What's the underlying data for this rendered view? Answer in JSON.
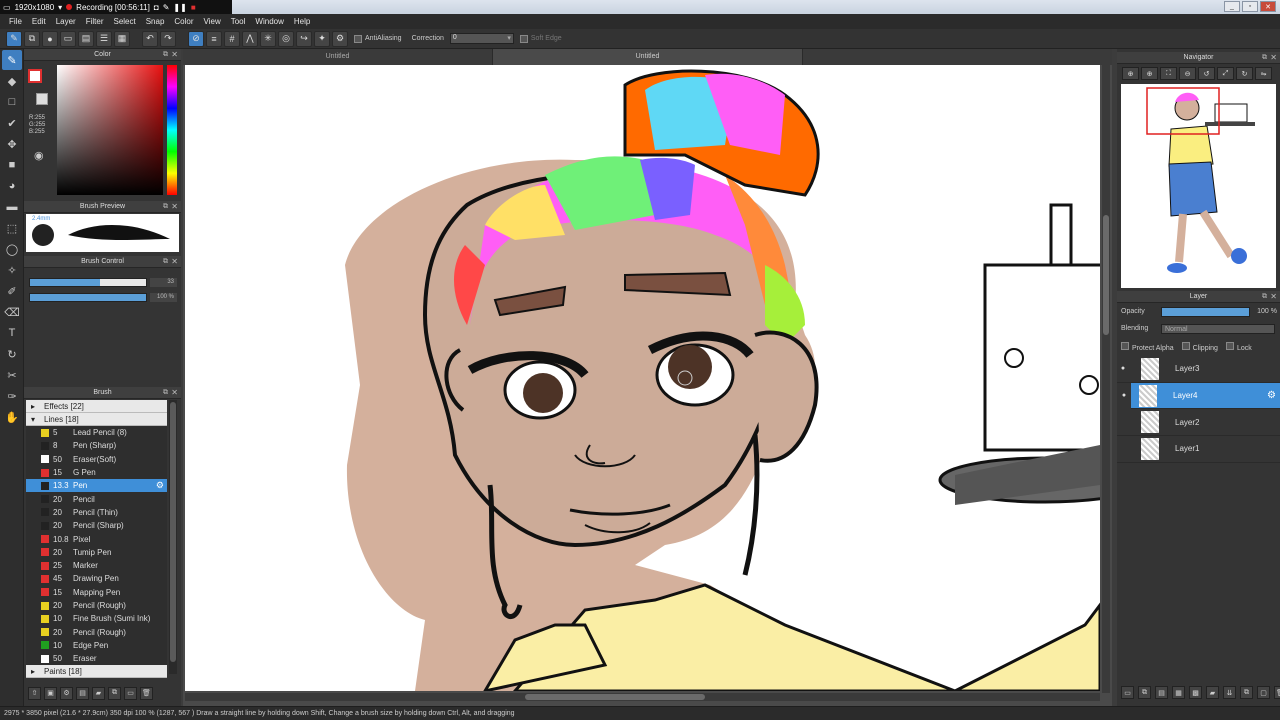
{
  "recorder": {
    "res": "1920x1080",
    "recording": "Recording [00:56:11]"
  },
  "menu": [
    "File",
    "Edit",
    "Layer",
    "Filter",
    "Select",
    "Snap",
    "Color",
    "View",
    "Tool",
    "Window",
    "Help"
  ],
  "toolbar": {
    "antialiasing": "AntiAliasing",
    "correction_label": "Correction",
    "correction_value": "0",
    "soft_edge": "Soft Edge"
  },
  "color_panel": {
    "title": "Color",
    "r": "R:255",
    "g": "G:255",
    "b": "B:255",
    "fg_color": "#ffffff"
  },
  "brush_preview": {
    "title": "Brush Preview",
    "size": "2.4mm"
  },
  "brush_control": {
    "title": "Brush Control",
    "size_value": "33",
    "size_fill": 0.6,
    "opacity_value": "100 %",
    "opacity_fill": 1.0
  },
  "brush_panel": {
    "title": "Brush",
    "groups": [
      {
        "label": "Effects [22]",
        "open": false
      },
      {
        "label": "Lines [18]",
        "open": true
      },
      {
        "label": "Paints [18]",
        "open": false
      }
    ],
    "items": [
      {
        "size": "5",
        "name": "Lead Pencil (8)",
        "color": "#e8d020"
      },
      {
        "size": "8",
        "name": "Pen (Sharp)",
        "color": "#222222"
      },
      {
        "size": "50",
        "name": "Eraser(Soft)",
        "color": "#ffffff"
      },
      {
        "size": "15",
        "name": "G Pen",
        "color": "#e03030"
      },
      {
        "size": "13.3",
        "name": "Pen",
        "color": "#222222",
        "selected": true
      },
      {
        "size": "20",
        "name": "Pencil",
        "color": "#222222"
      },
      {
        "size": "20",
        "name": "Pencil (Thin)",
        "color": "#222222"
      },
      {
        "size": "20",
        "name": "Pencil (Sharp)",
        "color": "#222222"
      },
      {
        "size": "10.8",
        "name": "Pixel",
        "color": "#e03030"
      },
      {
        "size": "20",
        "name": "Tumip Pen",
        "color": "#e03030"
      },
      {
        "size": "25",
        "name": "Marker",
        "color": "#e03030"
      },
      {
        "size": "45",
        "name": "Drawing Pen",
        "color": "#e03030"
      },
      {
        "size": "15",
        "name": "Mapping Pen",
        "color": "#e03030"
      },
      {
        "size": "20",
        "name": "Pencil (Rough)",
        "color": "#e8d020"
      },
      {
        "size": "10",
        "name": "Fine Brush (Sumi Ink)",
        "color": "#e8d020"
      },
      {
        "size": "20",
        "name": "Pencil (Rough)",
        "color": "#e8d020"
      },
      {
        "size": "10",
        "name": "Edge Pen",
        "color": "#20a020"
      },
      {
        "size": "50",
        "name": "Eraser",
        "color": "#ffffff"
      }
    ]
  },
  "canvas": {
    "tabs": [
      "Untitled",
      "Untitled"
    ]
  },
  "navigator": {
    "title": "Navigator"
  },
  "layer_panel": {
    "title": "Layer",
    "opacity_label": "Opacity",
    "opacity_value": "100 %",
    "blending_label": "Blending",
    "blending_value": "Normal",
    "protect_alpha": "Protect Alpha",
    "clipping": "Clipping",
    "lock": "Lock",
    "layers": [
      {
        "name": "Layer3",
        "visible": true,
        "selected": false
      },
      {
        "name": "Layer4",
        "visible": true,
        "selected": true
      },
      {
        "name": "Layer2",
        "visible": false,
        "selected": false
      },
      {
        "name": "Layer1",
        "visible": false,
        "selected": false
      }
    ]
  },
  "status": "2975 * 3850 pixel  (21.6 * 27.9cm)  350 dpi  100 %  (1287, 567 )  Draw a straight line by holding down Shift, Change a brush size by holding down Ctrl, Alt, and dragging"
}
